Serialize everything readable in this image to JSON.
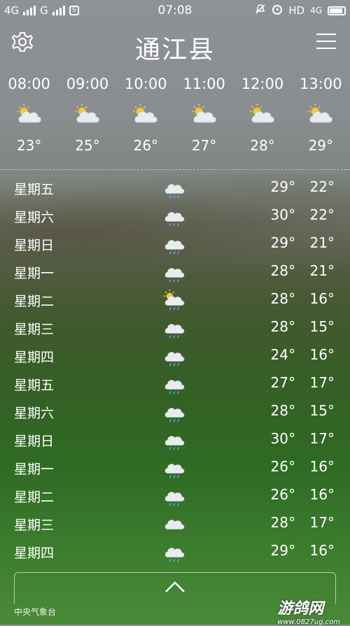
{
  "status_bar": {
    "net1": "4G",
    "net2": "G",
    "sim": "S",
    "time": "07:08",
    "hd": "HD",
    "net3": "4G"
  },
  "header": {
    "city": "通江县"
  },
  "hourly": [
    {
      "time": "08:00",
      "temp": "23°",
      "icon": "partly-cloudy-sun-icon"
    },
    {
      "time": "09:00",
      "temp": "25°",
      "icon": "partly-cloudy-sun-icon"
    },
    {
      "time": "10:00",
      "temp": "26°",
      "icon": "partly-cloudy-sun-icon"
    },
    {
      "time": "11:00",
      "temp": "27°",
      "icon": "partly-cloudy-sun-icon"
    },
    {
      "time": "12:00",
      "temp": "28°",
      "icon": "partly-cloudy-sun-icon"
    },
    {
      "time": "13:00",
      "temp": "29°",
      "icon": "partly-cloudy-sun-icon"
    }
  ],
  "daily": [
    {
      "day": "星期五",
      "icon": "rain-icon",
      "high": "29°",
      "low": "22°"
    },
    {
      "day": "星期六",
      "icon": "rain-icon",
      "high": "30°",
      "low": "22°"
    },
    {
      "day": "星期日",
      "icon": "rain-icon",
      "high": "29°",
      "low": "21°"
    },
    {
      "day": "星期一",
      "icon": "rain-icon",
      "high": "28°",
      "low": "21°"
    },
    {
      "day": "星期二",
      "icon": "sun-rain-icon",
      "high": "28°",
      "low": "16°"
    },
    {
      "day": "星期三",
      "icon": "rain-icon",
      "high": "28°",
      "low": "15°"
    },
    {
      "day": "星期四",
      "icon": "rain-icon",
      "high": "24°",
      "low": "16°"
    },
    {
      "day": "星期五",
      "icon": "rain-icon",
      "high": "27°",
      "low": "17°"
    },
    {
      "day": "星期六",
      "icon": "rain-icon",
      "high": "28°",
      "low": "15°"
    },
    {
      "day": "星期日",
      "icon": "rain-icon",
      "high": "30°",
      "low": "17°"
    },
    {
      "day": "星期一",
      "icon": "rain-icon",
      "high": "26°",
      "low": "16°"
    },
    {
      "day": "星期二",
      "icon": "rain-icon",
      "high": "26°",
      "low": "16°"
    },
    {
      "day": "星期三",
      "icon": "cloudy-icon",
      "high": "28°",
      "low": "17°"
    },
    {
      "day": "星期四",
      "icon": "rain-icon",
      "high": "29°",
      "low": "16°"
    }
  ],
  "footer": {
    "source": "中央气象台",
    "watermark": "游鸽网",
    "watermark_url": "www.0827ug.com"
  }
}
